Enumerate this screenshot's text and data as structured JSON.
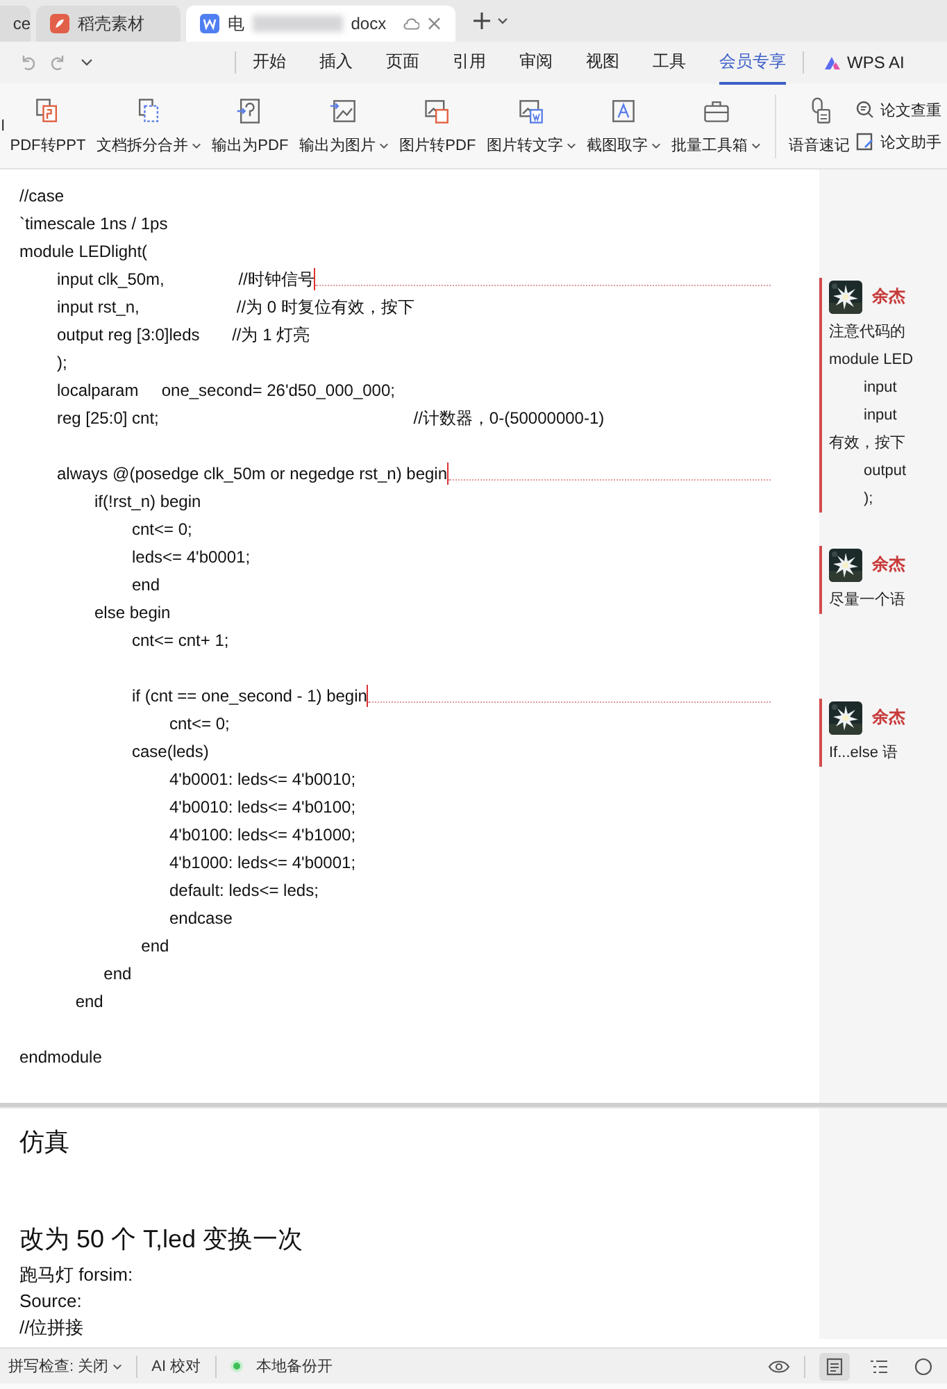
{
  "browser_tabs": [
    {
      "title": "ce",
      "kind": "plain",
      "selected": false
    },
    {
      "title": "稻壳素材",
      "kind": "docer",
      "selected": false
    },
    {
      "title": "电",
      "title_end": "docx",
      "kind": "doc",
      "selected": true
    }
  ],
  "menu_tabs": [
    {
      "label": "开始",
      "selected": false
    },
    {
      "label": "插入",
      "selected": false
    },
    {
      "label": "页面",
      "selected": false
    },
    {
      "label": "引用",
      "selected": false
    },
    {
      "label": "审阅",
      "selected": false
    },
    {
      "label": "视图",
      "selected": false
    },
    {
      "label": "工具",
      "selected": false
    },
    {
      "label": "会员专享",
      "selected": true
    }
  ],
  "wps_ai": {
    "label": "WPS AI"
  },
  "toolbar": [
    {
      "label": "l",
      "kind": "cut",
      "has_menu": false
    },
    {
      "label": "PDF转PPT",
      "kind": "big",
      "has_menu": false
    },
    {
      "label": "文档拆分合并",
      "kind": "big",
      "has_menu": true
    },
    {
      "label": "输出为PDF",
      "kind": "big",
      "has_menu": false
    },
    {
      "label": "输出为图片",
      "kind": "big",
      "has_menu": true
    },
    {
      "label": "图片转PDF",
      "kind": "big",
      "has_menu": false
    },
    {
      "label": "图片转文字",
      "kind": "big",
      "has_menu": true
    },
    {
      "label": "截图取字",
      "kind": "big",
      "has_menu": true
    },
    {
      "label": "批量工具箱",
      "kind": "big",
      "has_menu": true
    },
    {
      "label": "语音速记",
      "kind": "big",
      "has_menu": false
    },
    {
      "label": "论文查重",
      "kind": "small",
      "has_menu": false
    },
    {
      "label": "论文助手",
      "kind": "small",
      "has_menu": false
    }
  ],
  "page_1": {
    "lines": [
      {
        "text": "//case",
        "anchor": false
      },
      {
        "text": "`timescale 1ns / 1ps",
        "anchor": false
      },
      {
        "text": "module LEDlight(",
        "anchor": false
      },
      {
        "text": "\tinput clk_50m,                //时钟信号",
        "anchor": true
      },
      {
        "text": "\tinput rst_n,                     //为 0 时复位有效，按下",
        "anchor": false
      },
      {
        "text": "\toutput reg [3:0]leds       //为 1 灯亮",
        "anchor": false
      },
      {
        "text": "\t);",
        "anchor": false
      },
      {
        "text": "\tlocalparam     one_second= 26'd50_000_000;",
        "anchor": false
      },
      {
        "text": "\treg [25:0] cnt;                                                       //计数器，0-(50000000-1)",
        "anchor": false
      },
      {
        "anchor": false
      },
      {
        "text": "\talways @(posedge clk_50m or negedge rst_n) begin",
        "anchor": true
      },
      {
        "text": "\t\tif(!rst_n) begin",
        "anchor": false
      },
      {
        "text": "\t\t\tcnt<= 0;",
        "anchor": false
      },
      {
        "text": "\t\t\tleds<= 4'b0001;",
        "anchor": false
      },
      {
        "text": "\t\t\tend",
        "anchor": false
      },
      {
        "text": "\t\telse begin",
        "anchor": false
      },
      {
        "text": "\t\t\tcnt<= cnt+ 1;",
        "anchor": false
      },
      {
        "anchor": false
      },
      {
        "text": "\t\t\tif (cnt == one_second - 1) begin",
        "anchor": true
      },
      {
        "text": "\t\t\t\tcnt<= 0;",
        "anchor": false
      },
      {
        "text": "\t\t\tcase(leds)",
        "anchor": false
      },
      {
        "text": "\t\t\t\t4'b0001: leds<= 4'b0010;",
        "anchor": false
      },
      {
        "text": "\t\t\t\t4'b0010: leds<= 4'b0100;",
        "anchor": false
      },
      {
        "text": "\t\t\t\t4'b0100: leds<= 4'b1000;",
        "anchor": false
      },
      {
        "text": "\t\t\t\t4'b1000: leds<= 4'b0001;",
        "anchor": false
      },
      {
        "text": "\t\t\t\tdefault: leds<= leds;",
        "anchor": false
      },
      {
        "text": "\t\t\t\tendcase",
        "anchor": false
      },
      {
        "text": "\t\t\t  end",
        "anchor": false
      },
      {
        "text": "\t\t  end",
        "anchor": false
      },
      {
        "text": "\t    end",
        "anchor": false
      },
      {
        "anchor": false
      },
      {
        "text": "endmodule",
        "anchor": false
      }
    ]
  },
  "comments": [
    {
      "author": "余杰",
      "lines": [
        "注意代码的",
        "module LED",
        "\tinput",
        "\tinput",
        "有效，按下",
        "\toutput",
        "\t);"
      ]
    },
    {
      "author": "余杰",
      "lines": [
        "尽量一个语"
      ]
    },
    {
      "author": "余杰",
      "lines": [
        "If...else 语"
      ]
    }
  ],
  "page_2": {
    "lines": [
      {
        "text": "仿真",
        "kind": "heading"
      },
      {
        "text": "改为 50 个 T,led 变换一次",
        "kind": "heading"
      },
      {
        "text": "跑马灯 forsim:",
        "kind": "body"
      },
      {
        "text": "Source:",
        "kind": "body"
      },
      {
        "text": "//位拼接",
        "kind": "body"
      }
    ]
  },
  "status_bar": {
    "spell_check": "拼写检查: 关闭",
    "ai_check": "AI 校对",
    "backup": "本地备份开",
    "views": [
      {
        "selected": true
      },
      {
        "selected": false
      },
      {
        "selected": false
      }
    ]
  }
}
